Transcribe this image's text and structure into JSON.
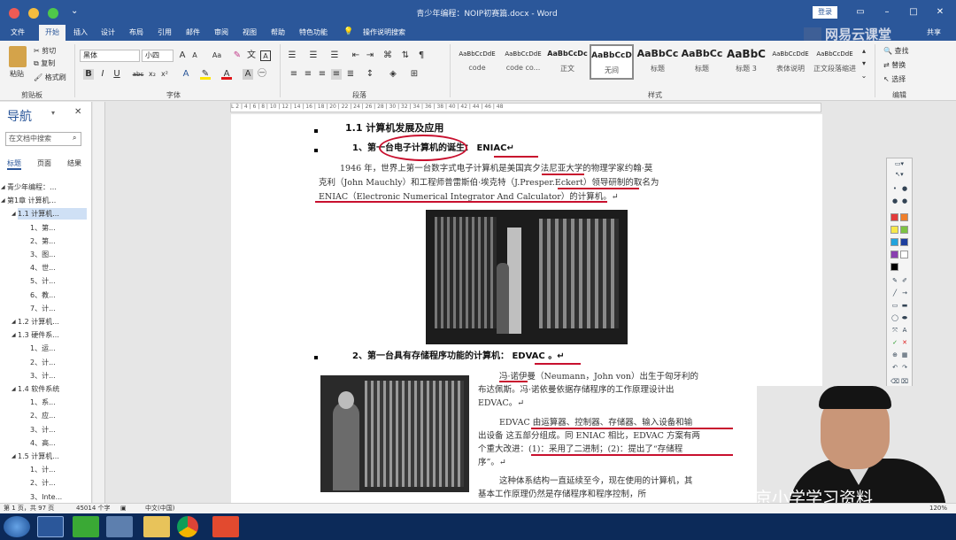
{
  "window": {
    "title": "青少年编程：NOIP初赛篇.docx  -  Word",
    "signin": "登录",
    "controls": [
      "restore-icon",
      "minimize-icon",
      "maximize-icon",
      "close-icon"
    ]
  },
  "ribbon_tabs": [
    "文件",
    "开始",
    "插入",
    "设计",
    "布局",
    "引用",
    "邮件",
    "审阅",
    "视图",
    "帮助",
    "特色功能",
    "操作说明搜索",
    "共享"
  ],
  "active_tab": "开始",
  "clipboard": {
    "paste": "粘贴",
    "cut": "剪切",
    "copy": "复制",
    "format_painter": "格式刷",
    "group": "剪贴板"
  },
  "font": {
    "name": "黑体",
    "size": "小四",
    "group": "字体"
  },
  "paragraph": {
    "group": "段落"
  },
  "styles": {
    "group": "样式",
    "items": [
      {
        "preview": "AaBbCcDdE",
        "name": "code"
      },
      {
        "preview": "AaBbCcDdE",
        "name": "code co..."
      },
      {
        "preview": "AaBbCcDc",
        "name": "正文"
      },
      {
        "preview": "AaBbCcD",
        "name": "无间"
      },
      {
        "preview": "AaBbCc",
        "name": "标题"
      },
      {
        "preview": "AaBbCc",
        "name": "标题"
      },
      {
        "preview": "AaBbC",
        "name": "标题 3"
      },
      {
        "preview": "AaBbCcDdE",
        "name": "表体说明"
      },
      {
        "preview": "AaBbCcDdE",
        "name": "正文段落缩进"
      }
    ]
  },
  "editing": {
    "find": "查找",
    "replace": "替换",
    "select": "选择",
    "group": "编辑"
  },
  "brand_watermark": "网易云课堂",
  "nav": {
    "title": "导航",
    "search_placeholder": "在文档中搜索",
    "tabs": [
      "标题",
      "页面",
      "结果"
    ],
    "items": [
      {
        "label": "青少年编程：…",
        "level": 0
      },
      {
        "label": "第1章 计算机...",
        "level": 0
      },
      {
        "label": "1.1 计算机...",
        "level": 1
      },
      {
        "label": "1、第...",
        "level": 2
      },
      {
        "label": "2、第...",
        "level": 2
      },
      {
        "label": "3、图...",
        "level": 2
      },
      {
        "label": "4、世...",
        "level": 2
      },
      {
        "label": "5、计...",
        "level": 2
      },
      {
        "label": "6、教...",
        "level": 2
      },
      {
        "label": "7、计...",
        "level": 2
      },
      {
        "label": "1.2 计算机...",
        "level": 1
      },
      {
        "label": "1.3 硬件系...",
        "level": 1
      },
      {
        "label": "1、运...",
        "level": 2
      },
      {
        "label": "2、计...",
        "level": 2
      },
      {
        "label": "3、计...",
        "level": 2
      },
      {
        "label": "1.4 软件系统",
        "level": 1
      },
      {
        "label": "1、系...",
        "level": 2
      },
      {
        "label": "2、应...",
        "level": 2
      },
      {
        "label": "3、计...",
        "level": 2
      },
      {
        "label": "4、高...",
        "level": 2
      },
      {
        "label": "1.5 计算机...",
        "level": 1
      },
      {
        "label": "1、计...",
        "level": 2
      },
      {
        "label": "2、计...",
        "level": 2
      },
      {
        "label": "3、Inte...",
        "level": 2
      }
    ]
  },
  "document": {
    "h2": "1.1  计算机发展及应用",
    "h3_1": "1、第一台电子计算机的诞生：  ENIAC↵",
    "para1_line1": "1946 年，世界上第一台数字式电子计算机是美国宾夕法尼亚大学的物理学家约翰·莫",
    "para1_line2": "克利（John Mauchly）和工程师普雷斯伯·埃克特（J.Presper.Eckert）领导研制的取名为",
    "para1_line3": "ENIAC（Electronic Numerical Integrator And Calculator）的计算机。↵",
    "h3_2": "2、第一台具有存储程序功能的计算机：  EDVAC 。↵",
    "p2_l1": "冯·诺伊曼（Neumann，John von）出生于匈牙利的",
    "p2_l2": "布达佩斯。冯·诺依曼依据存储程序的工作原理设计出",
    "p2_l3": "EDVAC。↵",
    "p3_l1": "EDVAC 由运算器、控制器、存储器、输入设备和输",
    "p3_l2": "出设备 这五部分组成。同 ENIAC 相比，EDVAC 方案有两",
    "p3_l3": "个重大改进：(1)：采用了二进制；(2)：提出了“存储程",
    "p3_l4": "序”。↵",
    "p4_l1": "这种体系结构一直延续至今，现在使用的计算机，其",
    "p4_l2": "基本工作原理仍然是存储程序和程序控制，所"
  },
  "ruler_ticks": "L  2  |  4  |  6  |  8  |  10  |  12  |  14  |  16  |  18  |  20  |  22  |  24  |  26  |  28  |  30  |  32  |  34  |  36  |  38  |  40  |  42  |  44  |  46  |  48",
  "status": {
    "page": "第 1 页，共 97 页",
    "words": "45014 个字",
    "lang": "中文(中国)",
    "zoom": "120%"
  },
  "video_watermark": "北京小学学习资料",
  "palette_colors": [
    "#e23b3b",
    "#f07f2a",
    "#f7e84a",
    "#7dc243",
    "#21a3dd",
    "#1d3f9e",
    "#8a3fb0",
    "#ffffff",
    "#000000"
  ],
  "taskbar_apps": [
    "start-icon",
    "word-icon",
    "camtasia-icon",
    "explorer-icon",
    "folder-icon",
    "chrome-icon",
    "recorder-icon"
  ]
}
